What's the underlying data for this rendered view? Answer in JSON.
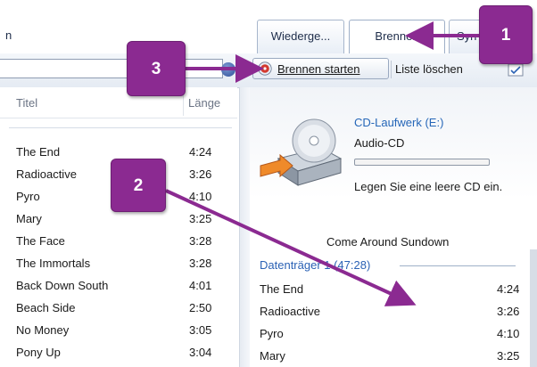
{
  "window": {
    "title_fragment": "n"
  },
  "tabs": [
    {
      "label": "Wiederge..."
    },
    {
      "label": "Brennen"
    },
    {
      "label": "Syn"
    }
  ],
  "toolbar": {
    "burn_start_label": "Brennen starten",
    "clear_list_label": "Liste löschen"
  },
  "left_list": {
    "columns": {
      "title": "Titel",
      "length": "Länge"
    },
    "rows": [
      {
        "title": "The End",
        "length": "4:24"
      },
      {
        "title": "Radioactive",
        "length": "3:26"
      },
      {
        "title": "Pyro",
        "length": "4:10"
      },
      {
        "title": "Mary",
        "length": "3:25"
      },
      {
        "title": "The Face",
        "length": "3:28"
      },
      {
        "title": "The Immortals",
        "length": "3:28"
      },
      {
        "title": "Back Down South",
        "length": "4:01"
      },
      {
        "title": "Beach Side",
        "length": "2:50"
      },
      {
        "title": "No Money",
        "length": "3:05"
      },
      {
        "title": "Pony Up",
        "length": "3:04"
      }
    ]
  },
  "burn_panel": {
    "drive_label": "CD-Laufwerk (E:)",
    "disc_type": "Audio-CD",
    "progress_fraction": 0.0,
    "insert_hint": "Legen Sie eine leere CD ein.",
    "album_title": "Come Around Sundown",
    "disc_group": "Datenträger 1 (47:28)",
    "rows": [
      {
        "title": "The End",
        "length": "4:24"
      },
      {
        "title": "Radioactive",
        "length": "3:26"
      },
      {
        "title": "Pyro",
        "length": "4:10"
      },
      {
        "title": "Mary",
        "length": "3:25"
      }
    ]
  },
  "callouts": {
    "one": "1",
    "two": "2",
    "three": "3"
  },
  "icons": {
    "burn": "burn-disc-icon",
    "search": "search-icon",
    "drive": "cd-drive-icon",
    "list_options": "list-options-icon"
  },
  "colors": {
    "callout": "#8b2a91",
    "link_blue": "#2667b8",
    "disc_group_blue": "#2b62b5"
  }
}
